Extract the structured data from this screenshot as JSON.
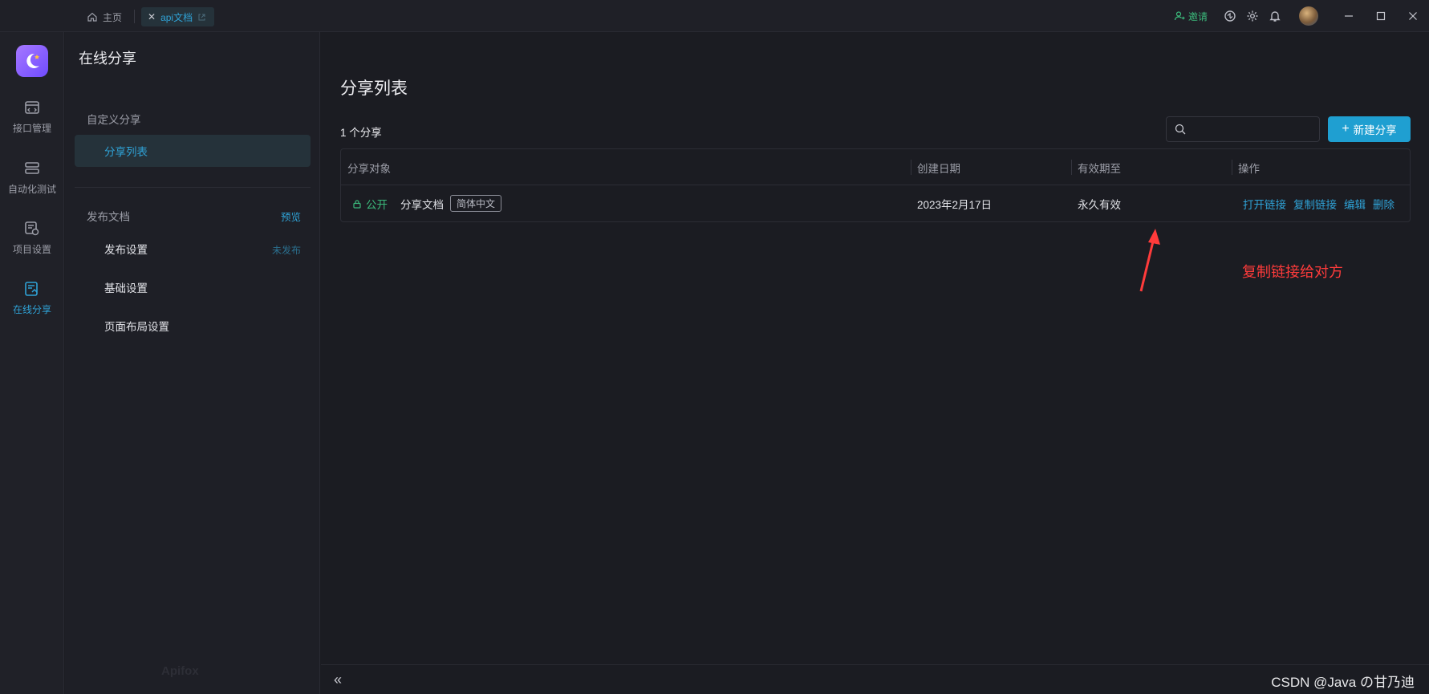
{
  "titlebar": {
    "home_tab": "主页",
    "active_tab": "api文档",
    "invite": "邀请"
  },
  "rail": {
    "items": [
      {
        "label": "接口管理"
      },
      {
        "label": "自动化测试"
      },
      {
        "label": "项目设置"
      },
      {
        "label": "在线分享"
      }
    ]
  },
  "sidebar": {
    "title": "在线分享",
    "group_custom": "自定义分享",
    "share_list": "分享列表",
    "group_publish": "发布文档",
    "preview_link": "预览",
    "publish_settings": "发布设置",
    "publish_status": "未发布",
    "basic_settings": "基础设置",
    "layout_settings": "页面布局设置",
    "watermark": "Apifox"
  },
  "main": {
    "title": "分享列表",
    "count": "1 个分享",
    "search_placeholder": "",
    "new_button": "新建分享",
    "columns": [
      "分享对象",
      "创建日期",
      "有效期至",
      "操作"
    ],
    "rows": [
      {
        "visibility": "公开",
        "name": "分享文档",
        "language": "简体中文",
        "created": "2023年2月17日",
        "expires": "永久有效",
        "actions": [
          "打开链接",
          "复制链接",
          "编辑",
          "删除"
        ]
      }
    ],
    "annotation": "复制链接给对方"
  },
  "footer": {
    "watermark": "CSDN @Java の甘乃迪"
  },
  "colors": {
    "accent": "#1f9fd1",
    "public_green": "#3bb97b",
    "annotation_red": "#ff3b3b"
  }
}
